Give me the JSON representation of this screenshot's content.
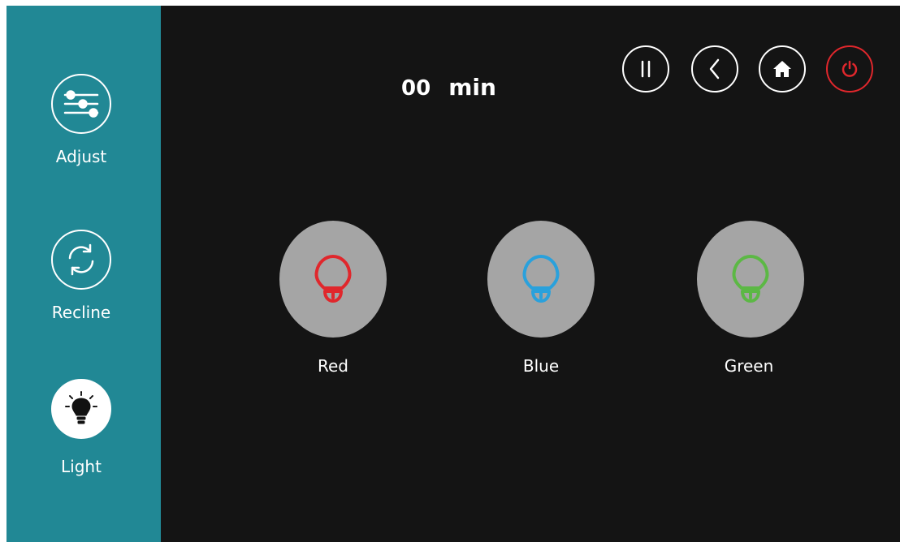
{
  "sidebar": {
    "items": [
      {
        "label": "Adjust",
        "icon": "sliders-icon",
        "active": false
      },
      {
        "label": "Recline",
        "icon": "recline-icon",
        "active": false
      },
      {
        "label": "Light",
        "icon": "lightbulb-icon",
        "active": true
      }
    ]
  },
  "timer": {
    "value": "00",
    "unit": "min"
  },
  "top_controls": {
    "icons": [
      "pause-icon",
      "back-icon",
      "home-icon",
      "power-icon"
    ]
  },
  "lights": [
    {
      "label": "Red",
      "color": "#e0272c",
      "icon": "lightbulb-icon"
    },
    {
      "label": "Blue",
      "color": "#2aa1dc",
      "icon": "lightbulb-icon"
    },
    {
      "label": "Green",
      "color": "#5cb845",
      "icon": "lightbulb-icon"
    }
  ],
  "colors": {
    "sidebar": "#218895",
    "background": "#141414",
    "power": "#e0272c",
    "light_button": "#a5a5a5"
  }
}
